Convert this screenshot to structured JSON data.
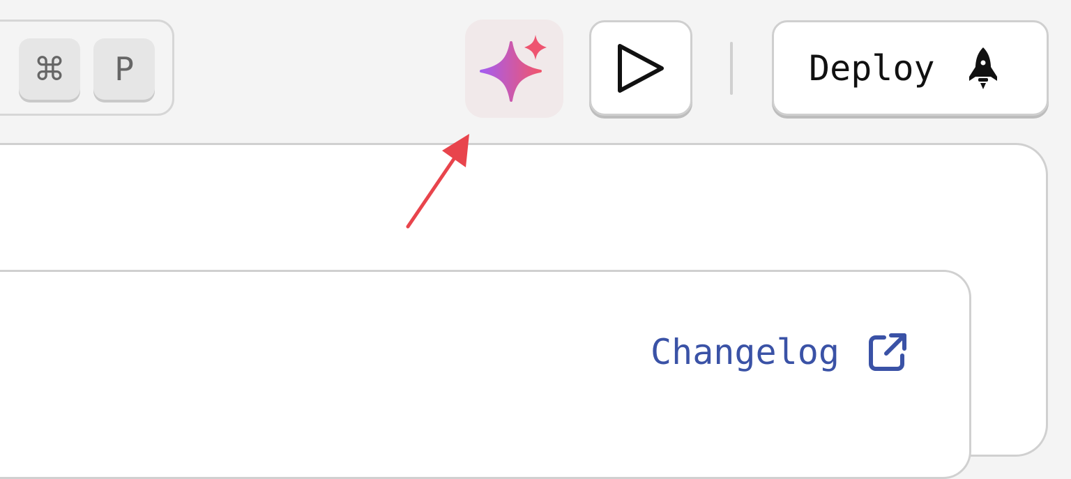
{
  "search": {
    "shortcut_keys": [
      "⌘",
      "P"
    ]
  },
  "toolbar": {
    "ai_icon": "sparkle-icon",
    "run_icon": "play-icon",
    "deploy_label": "Deploy",
    "deploy_icon": "rocket-icon"
  },
  "main": {
    "changelog_label": "Changelog",
    "changelog_icon": "external-link-icon"
  },
  "colors": {
    "background": "#f4f4f4",
    "ai_button_bg": "#f1e9ea",
    "sparkle_gradient_start": "#a45cf0",
    "sparkle_gradient_end": "#f0566d",
    "link": "#3a52a6",
    "annotation_arrow": "#e8444c"
  }
}
